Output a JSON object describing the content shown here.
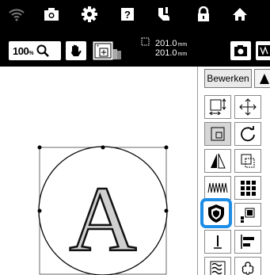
{
  "zoom": {
    "value": "100",
    "unit": "%"
  },
  "dimensions": {
    "width_value": "201.0",
    "width_unit": "mm",
    "height_value": "201.0",
    "height_unit": "mm"
  },
  "panel": {
    "edit_tab_label": "Bewerken"
  },
  "canvas": {
    "letter": "A"
  },
  "colors": {
    "selection": "#1d8de6",
    "bar": "#000000"
  }
}
